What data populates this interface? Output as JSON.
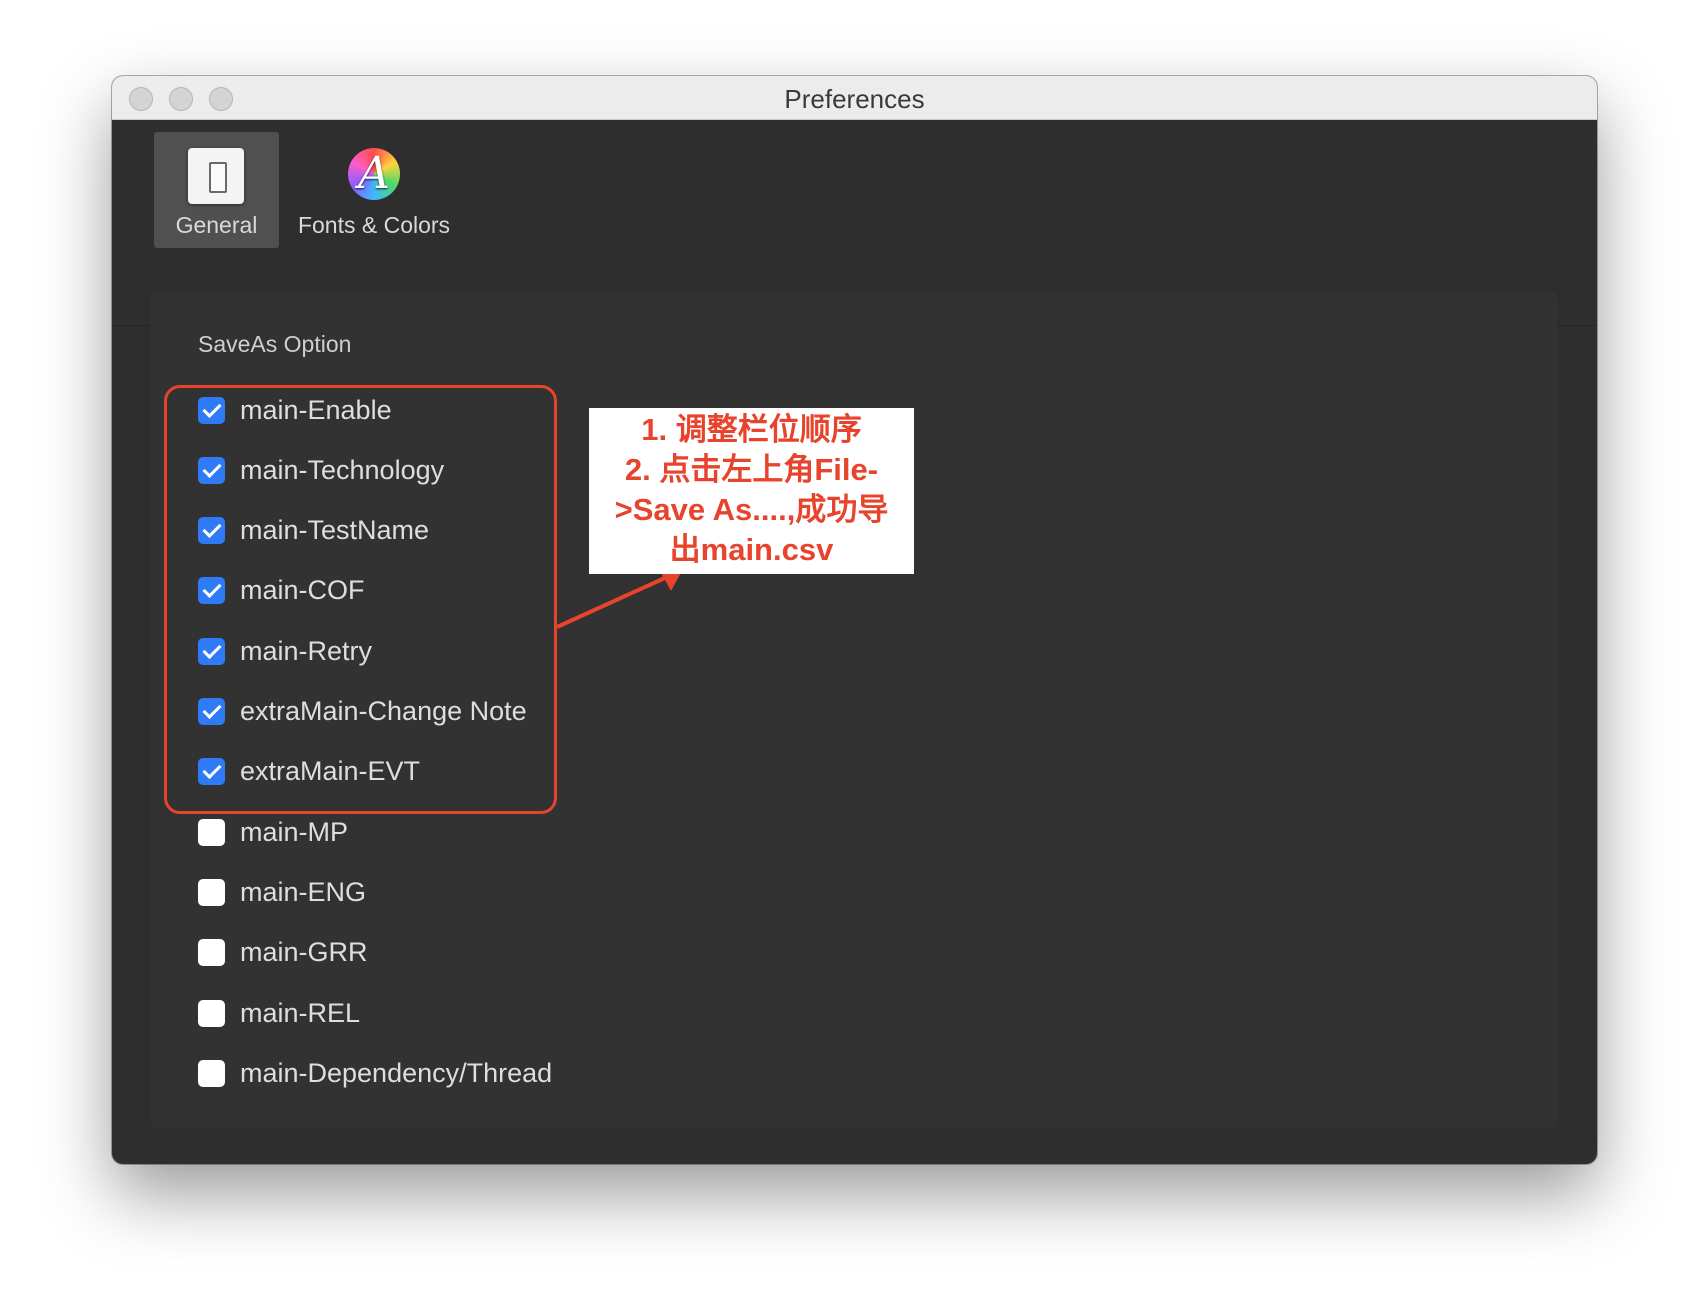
{
  "window": {
    "title": "Preferences"
  },
  "toolbar": {
    "tabs": [
      {
        "label": "General",
        "icon": "general-icon",
        "selected": true
      },
      {
        "label": "Fonts & Colors",
        "icon": "fonts-colors-icon",
        "selected": false
      }
    ]
  },
  "section": {
    "title": "SaveAs Option"
  },
  "options": [
    {
      "label": "main-Enable",
      "checked": true
    },
    {
      "label": "main-Technology",
      "checked": true
    },
    {
      "label": "main-TestName",
      "checked": true
    },
    {
      "label": "main-COF",
      "checked": true
    },
    {
      "label": "main-Retry",
      "checked": true
    },
    {
      "label": "extraMain-Change Note",
      "checked": true
    },
    {
      "label": "extraMain-EVT",
      "checked": true
    },
    {
      "label": "main-MP",
      "checked": false
    },
    {
      "label": "main-ENG",
      "checked": false
    },
    {
      "label": "main-GRR",
      "checked": false
    },
    {
      "label": "main-REL",
      "checked": false
    },
    {
      "label": "main-Dependency/Thread",
      "checked": false
    }
  ],
  "annotation": {
    "lines": [
      "1. 调整栏位顺序",
      "2. 点击左上角File-",
      ">Save As....,成功导",
      "出main.csv"
    ],
    "color": "#e8432c"
  },
  "colors": {
    "checkbox_checked": "#2f7bf5",
    "window_bg": "#2e2e2e"
  }
}
